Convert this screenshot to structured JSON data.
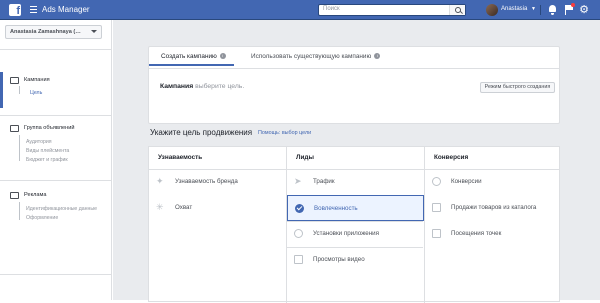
{
  "topbar": {
    "logo": "f",
    "app_title": "Ads Manager",
    "search_placeholder": "Поиск",
    "user_name": "Anastasia",
    "icons": [
      "menu-icon",
      "search-icon",
      "bell-icon",
      "flag-icon",
      "gear-icon"
    ]
  },
  "sidebar": {
    "account": "Anastasia Zamashnaya (…",
    "sections": [
      {
        "title": "Кампания",
        "items": [
          "Цель"
        ]
      },
      {
        "title": "Группа объявлений",
        "items": [
          "Аудитория",
          "Виды плейсмента",
          "Бюджет и график"
        ]
      },
      {
        "title": "Реклама",
        "items": [
          "Идентификационные данные",
          "Оформление"
        ]
      }
    ]
  },
  "campaign_card": {
    "tabs": [
      "Создать кампанию",
      "Использовать существующую кампанию"
    ],
    "label": "Кампания",
    "hint": "выберите цель.",
    "quick_button": "Режим быстрого создания"
  },
  "goal": {
    "title": "Укажите цель продвижения",
    "help_link": "Помощь: выбор цели",
    "columns": [
      {
        "header": "Узнаваемость",
        "options": [
          "Узнаваемость бренда",
          "Охват"
        ]
      },
      {
        "header": "Лиды",
        "options": [
          "Трафик",
          "Вовлеченность",
          "Установки приложения",
          "Просмотры видео"
        ]
      },
      {
        "header": "Конверсия",
        "options": [
          "Конверсии",
          "Продажи товаров из каталога",
          "Посещения точек"
        ]
      }
    ],
    "selected": "Вовлеченность"
  },
  "colors": {
    "brand": "#4267b2",
    "background": "#e9ebee"
  }
}
